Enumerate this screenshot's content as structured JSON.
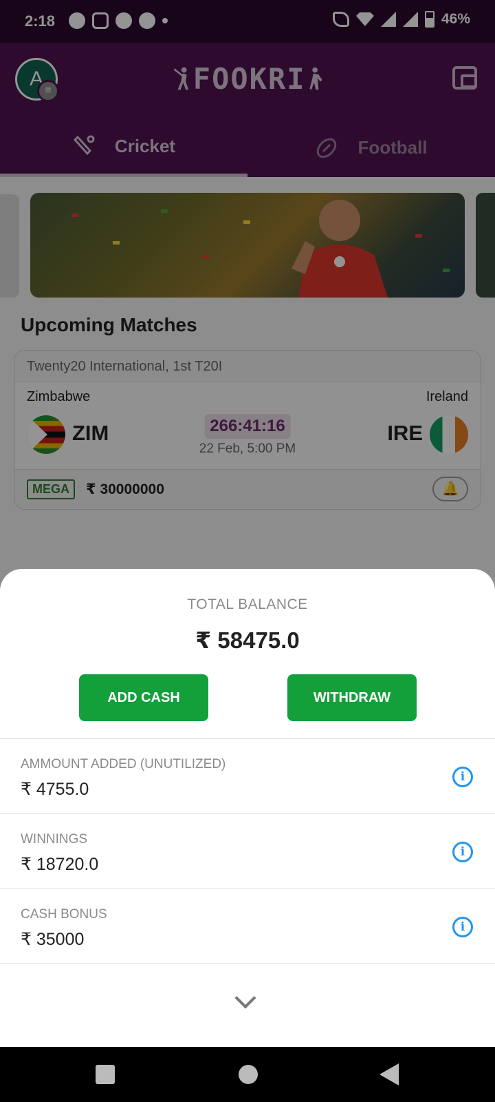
{
  "status_bar": {
    "time": "2:18",
    "battery": "46%"
  },
  "header": {
    "avatar_initial": "A",
    "logo_text": "FOOKRI"
  },
  "tabs": [
    {
      "label": "Cricket",
      "active": true
    },
    {
      "label": "Football",
      "active": false
    }
  ],
  "upcoming": {
    "title": "Upcoming Matches",
    "match": {
      "series": "Twenty20 International, 1st T20I",
      "team1": {
        "name": "Zimbabwe",
        "code": "ZIM"
      },
      "team2": {
        "name": "Ireland",
        "code": "IRE"
      },
      "countdown": "266:41:16",
      "date": "22 Feb, 5:00 PM",
      "contest_tag": "MEGA",
      "prize": "₹ 30000000"
    }
  },
  "balance_sheet": {
    "label": "TOTAL BALANCE",
    "total": "₹ 58475.0",
    "add_cash": "ADD CASH",
    "withdraw": "WITHDRAW",
    "rows": [
      {
        "label": "AMMOUNT ADDED (UNUTILIZED)",
        "value": "₹ 4755.0"
      },
      {
        "label": "WINNINGS",
        "value": "₹ 18720.0"
      },
      {
        "label": "CASH BONUS",
        "value": "₹ 35000"
      }
    ]
  },
  "icons": {
    "info": "info-icon",
    "chevron": "chevron-down-icon",
    "wallet": "wallet-icon",
    "bell": "bell-plus-icon"
  },
  "colors": {
    "header": "#4e1250",
    "status_bar": "#2c0a2e",
    "primary_button": "#13a03a",
    "info": "#2196f3"
  }
}
